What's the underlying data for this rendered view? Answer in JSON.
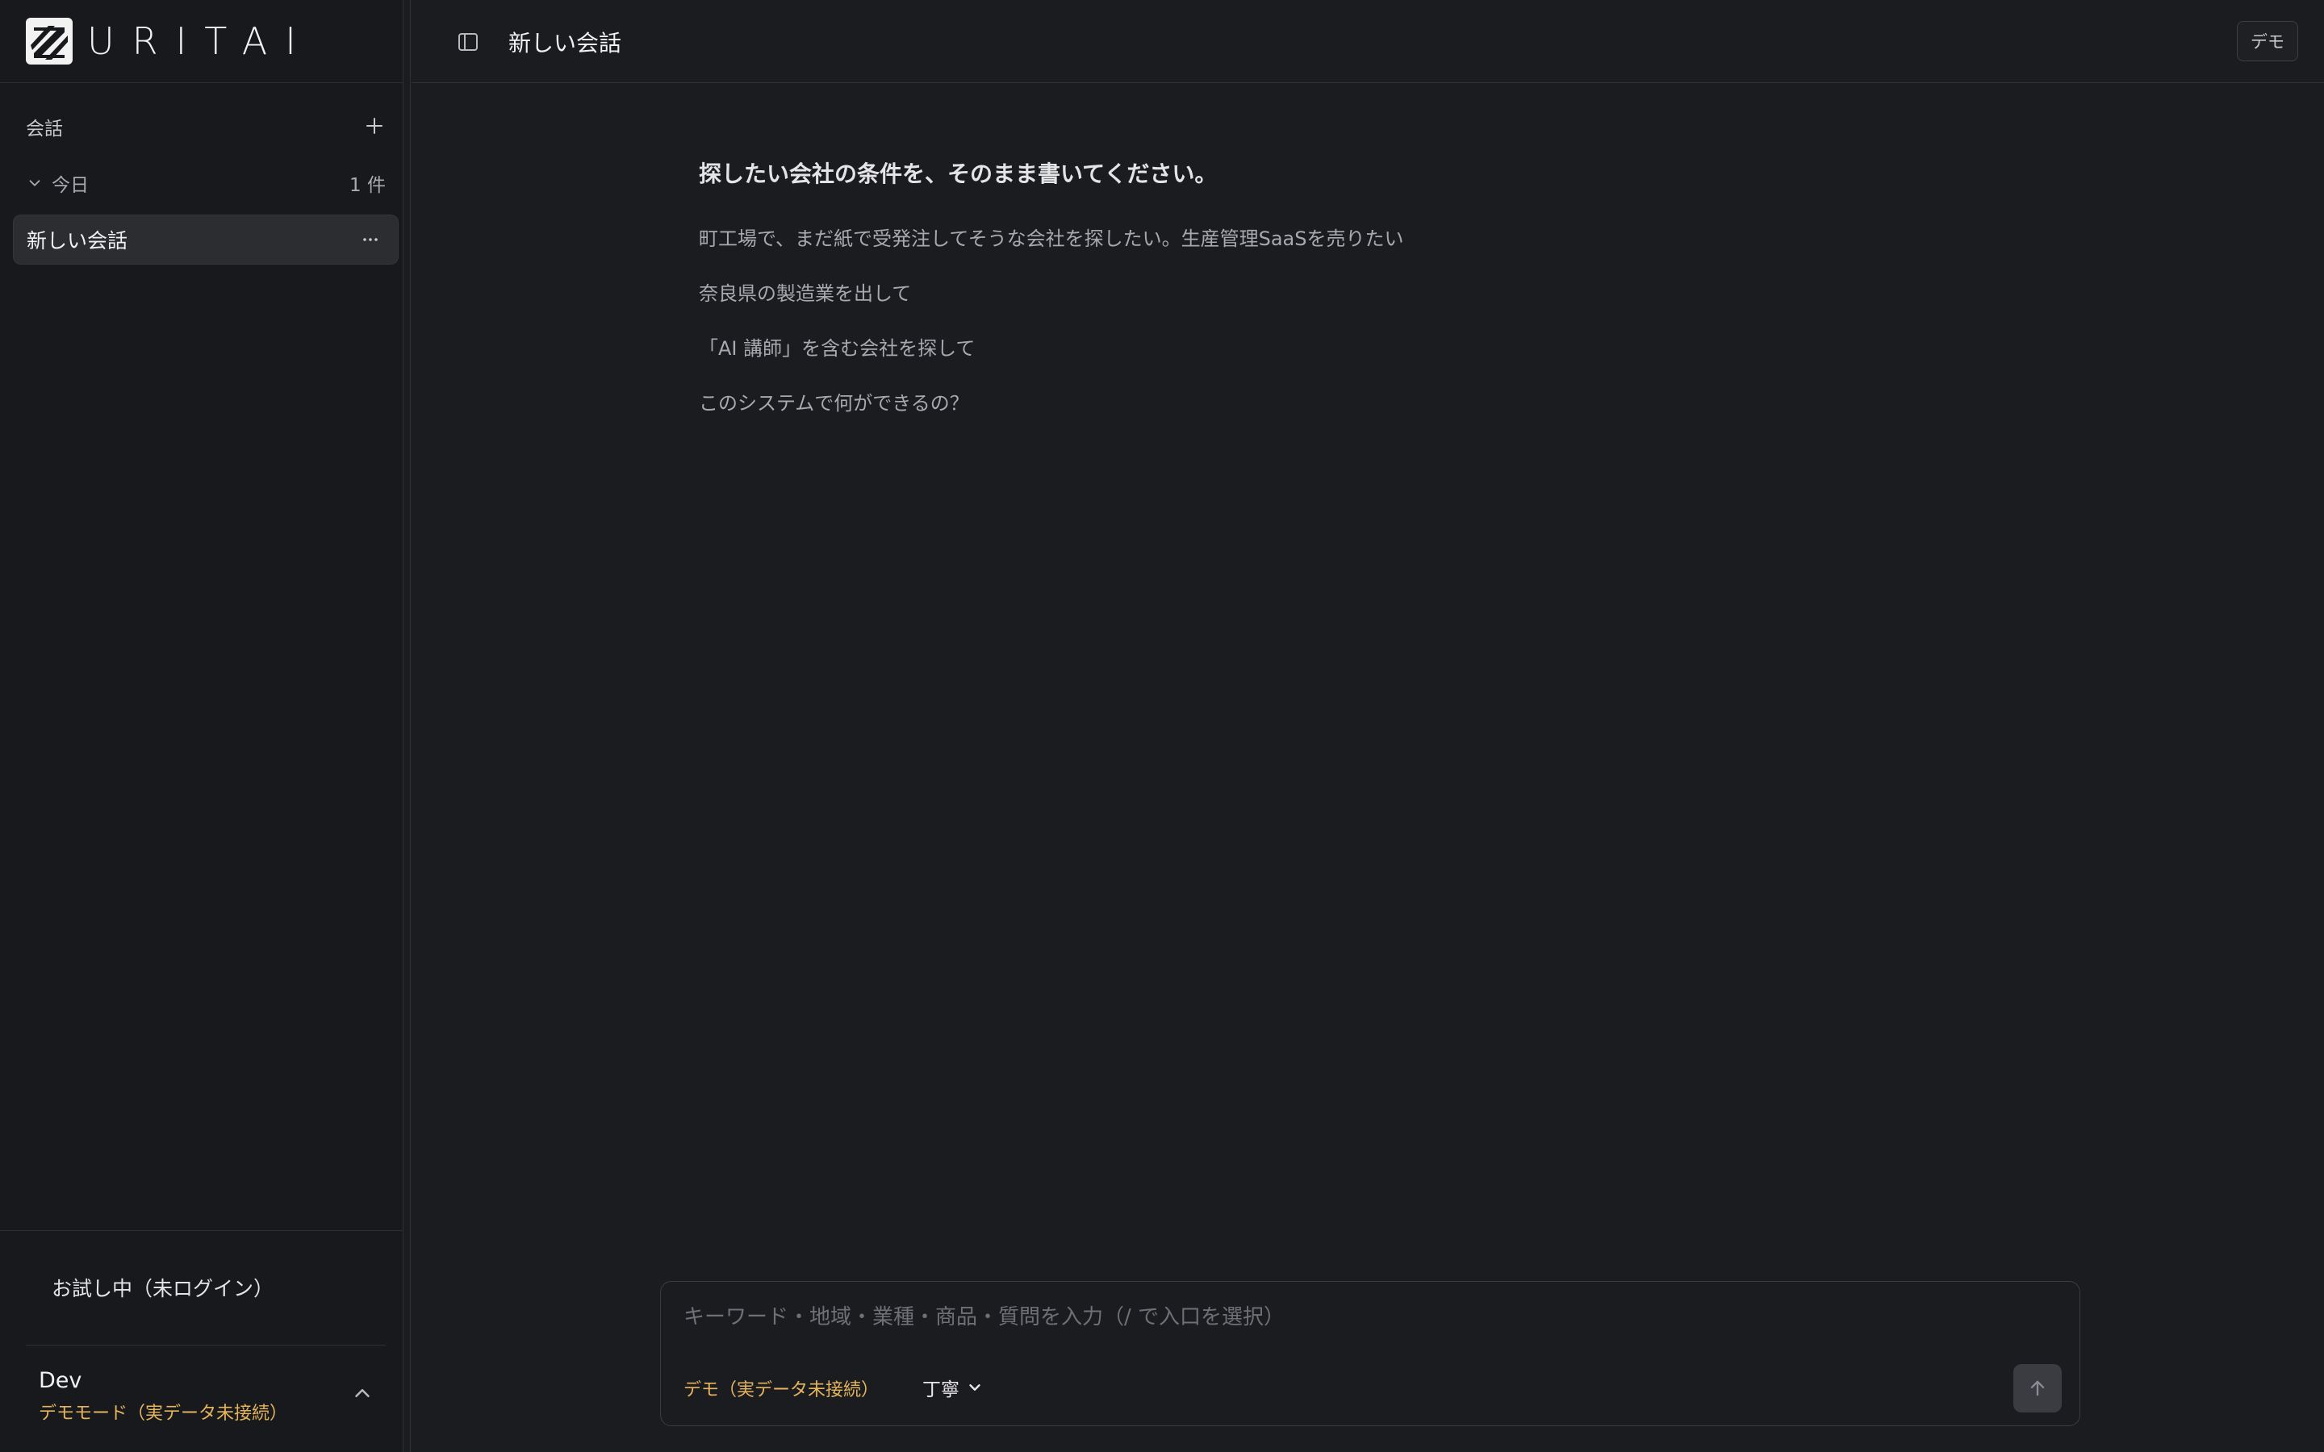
{
  "app": {
    "logo_text": "URITAI"
  },
  "sidebar": {
    "section_label": "会話",
    "add_icon": "plus-icon",
    "group": {
      "label": "今日",
      "count": "1 件"
    },
    "conversations": [
      {
        "title": "新しい会話",
        "active": true
      }
    ],
    "trial_label": "お試し中（未ログイン）",
    "user": {
      "name": "Dev",
      "mode": "デモモード（実データ未接続）"
    }
  },
  "header": {
    "title": "新しい会話",
    "badge": "デモ"
  },
  "main": {
    "intro_title": "探したい会社の条件を、そのまま書いてください。",
    "suggestions": [
      "町工場で、まだ紙で受発注してそうな会社を探したい。生産管理SaaSを売りたい",
      "奈良県の製造業を出して",
      "「AI 講師」を含む会社を探して",
      "このシステムで何ができるの？"
    ]
  },
  "composer": {
    "placeholder": "キーワード・地域・業種・商品・質問を入力（/ で入口を選択）",
    "value": "",
    "mode_label": "デモ（実データ未接続）",
    "tone": "丁寧"
  },
  "colors": {
    "background": "#1b1c20",
    "sidebar": "#18191c",
    "accent_warning": "#e5b45c",
    "text_primary": "#f1f1f3",
    "text_muted": "#a7a9ae"
  }
}
